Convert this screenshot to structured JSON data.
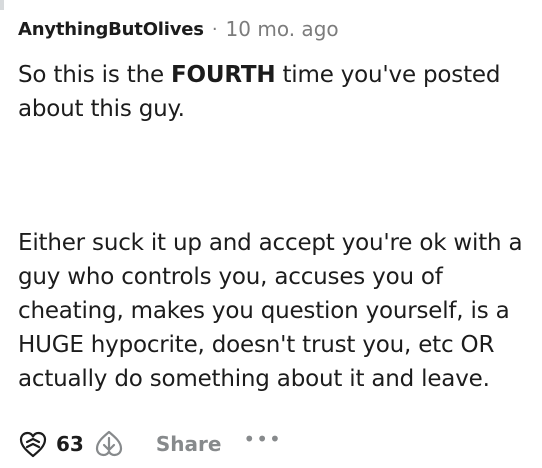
{
  "comment": {
    "username": "AnythingButOlives",
    "separator": "·",
    "timestamp": "10 mo. ago",
    "paragraph1": {
      "before": "So this is the ",
      "bold": "FOURTH",
      "after": " time you've posted about this guy."
    },
    "paragraph2": "Either suck it up and accept you're ok with a guy who controls you, accuses you of cheating, makes you question yourself, is a HUGE hypocrite, doesn't trust you, etc OR actually do something about it and leave."
  },
  "actions": {
    "upvote_icon": "upvote-heart-icon",
    "vote_count": "63",
    "downvote_icon": "downvote-heart-icon",
    "share_label": "Share",
    "more_label": "•••"
  },
  "colors": {
    "text": "#1c1c1c",
    "muted": "#7c7c7c",
    "action_gray": "#878a8c"
  }
}
